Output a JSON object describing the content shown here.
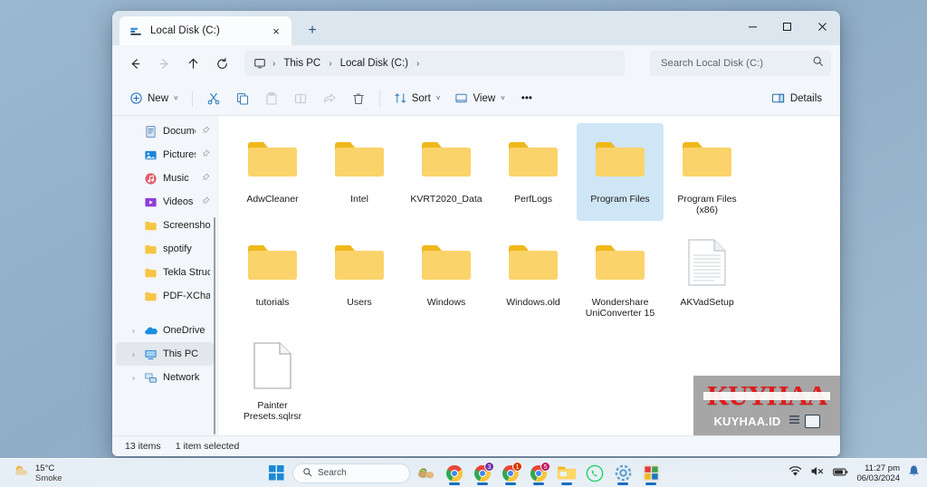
{
  "window": {
    "tab": {
      "title": "Local Disk (C:)",
      "icon": "drive-icon",
      "close_label": "×"
    },
    "new_tab_label": "+",
    "controls": {
      "minimize": "–",
      "maximize": "□",
      "close": "×"
    }
  },
  "nav": {
    "back": "←",
    "forward": "→",
    "up": "↑",
    "refresh": "⟳",
    "breadcrumb": [
      {
        "label": "This PC"
      },
      {
        "label": "Local Disk (C:)"
      }
    ],
    "breadcrumb_sep": "›"
  },
  "search": {
    "placeholder": "Search Local Disk (C:)",
    "value": ""
  },
  "toolbar": {
    "new_label": "New",
    "cut_label": "Cut",
    "copy_label": "Copy",
    "paste_label": "Paste",
    "rename_label": "Rename",
    "share_label": "Share",
    "delete_label": "Delete",
    "sort_label": "Sort",
    "view_label": "View",
    "more_label": "•••",
    "details_label": "Details",
    "caret": "˅"
  },
  "sidebar": {
    "items": [
      {
        "label": "Documents",
        "icon": "documents-icon",
        "pinned": true,
        "chevron": false,
        "selected": false
      },
      {
        "label": "Pictures",
        "icon": "pictures-icon",
        "pinned": true,
        "chevron": false,
        "selected": false
      },
      {
        "label": "Music",
        "icon": "music-icon",
        "pinned": true,
        "chevron": false,
        "selected": false
      },
      {
        "label": "Videos",
        "icon": "videos-icon",
        "pinned": true,
        "chevron": false,
        "selected": false
      },
      {
        "label": "Screenshots",
        "icon": "folder-icon",
        "pinned": false,
        "chevron": false,
        "selected": false
      },
      {
        "label": "spotify",
        "icon": "folder-icon",
        "pinned": false,
        "chevron": false,
        "selected": false
      },
      {
        "label": "Tekla Structures",
        "icon": "folder-icon",
        "pinned": false,
        "chevron": false,
        "selected": false
      },
      {
        "label": "PDF-XChange P",
        "icon": "folder-icon",
        "pinned": false,
        "chevron": false,
        "selected": false
      }
    ],
    "roots": [
      {
        "label": "OneDrive",
        "icon": "onedrive-icon",
        "chevron": true,
        "selected": false
      },
      {
        "label": "This PC",
        "icon": "this-pc-icon",
        "chevron": true,
        "selected": true
      },
      {
        "label": "Network",
        "icon": "network-icon",
        "chevron": true,
        "selected": false
      }
    ],
    "chevron_glyph": "›"
  },
  "files": [
    {
      "name": "AdwCleaner",
      "type": "folder",
      "selected": false
    },
    {
      "name": "Intel",
      "type": "folder",
      "selected": false
    },
    {
      "name": "KVRT2020_Data",
      "type": "folder",
      "selected": false
    },
    {
      "name": "PerfLogs",
      "type": "folder",
      "selected": false
    },
    {
      "name": "Program Files",
      "type": "folder",
      "selected": true
    },
    {
      "name": "Program Files (x86)",
      "type": "folder",
      "selected": false
    },
    {
      "name": "tutorials",
      "type": "folder",
      "selected": false
    },
    {
      "name": "Users",
      "type": "folder",
      "selected": false
    },
    {
      "name": "Windows",
      "type": "folder",
      "selected": false
    },
    {
      "name": "Windows.old",
      "type": "folder",
      "selected": false
    },
    {
      "name": "Wondershare UniConverter 15",
      "type": "folder",
      "selected": false
    },
    {
      "name": "AKVadSetup",
      "type": "text-file",
      "selected": false
    },
    {
      "name": "Painter Presets.sqlrsr",
      "type": "blank-file",
      "selected": false
    }
  ],
  "status": {
    "item_count": "13 items",
    "selection": "1 item selected"
  },
  "watermark": {
    "big": "KUYHAA",
    "small_left": "KUY",
    "small_mid": "HAA",
    "small_right": ".ID"
  },
  "taskbar": {
    "weather": {
      "temp": "15°C",
      "condition": "Smoke",
      "icon": "sun-cloud-icon"
    },
    "search_label": "Search",
    "apps": [
      {
        "name": "paint-3d-icon",
        "badge": "",
        "badge_color": "",
        "active": false
      },
      {
        "name": "chrome-icon-1",
        "badge": "",
        "badge_color": "#2f2f2f",
        "active": true
      },
      {
        "name": "chrome-icon-2",
        "badge": "3",
        "badge_color": "#6f2da8",
        "active": true
      },
      {
        "name": "chrome-icon-3",
        "badge": "1",
        "badge_color": "#d83b01",
        "active": true
      },
      {
        "name": "chrome-icon-4",
        "badge": "5",
        "badge_color": "#c2185b",
        "active": true
      },
      {
        "name": "file-explorer-icon",
        "badge": "",
        "badge_color": "",
        "active": true
      },
      {
        "name": "whatsapp-icon",
        "badge": "",
        "badge_color": "",
        "active": false
      },
      {
        "name": "settings-icon",
        "badge": "",
        "badge_color": "",
        "active": true
      },
      {
        "name": "store-icon",
        "badge": "",
        "badge_color": "",
        "active": true
      }
    ],
    "tray": {
      "wifi": "wifi-icon",
      "volume": "volume-muted-icon",
      "battery": "battery-icon",
      "notification": "bell-icon"
    },
    "clock": {
      "time": "11:27 pm",
      "date": "06/03/2024"
    }
  },
  "colors": {
    "folder": "#f7c544",
    "accent": "#0b6fc4",
    "selection": "#cfe6f7",
    "watermark_red": "#e01b1b"
  }
}
